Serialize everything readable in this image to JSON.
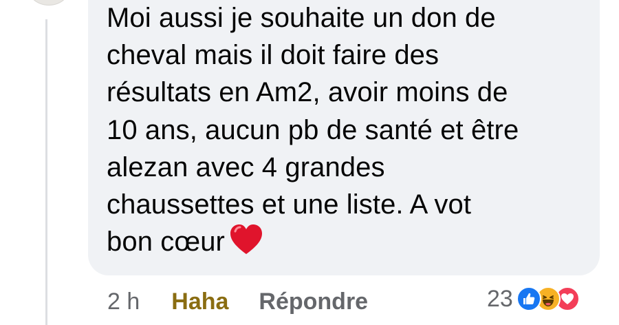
{
  "comment": {
    "lines": [
      "Moi aussi je souhaite un don de",
      "cheval mais il doit faire des",
      "résultats en Am2, avoir moins de",
      "10 ans, aucun pb de santé et être",
      "alezan avec 4 grandes",
      "chaussettes et une liste. A vot",
      "bon cœur"
    ],
    "emoji": "heart-emoji"
  },
  "meta": {
    "time": "2 h",
    "haha_label": "Haha",
    "reply_label": "Répondre"
  },
  "reactions": {
    "count": "23",
    "icons": [
      "like-icon",
      "haha-icon",
      "love-icon"
    ]
  },
  "colors": {
    "bubble": "#f0f2f5",
    "text": "#050505",
    "muted": "#65676b",
    "haha": "#8a6d12",
    "like": "#1877f2",
    "love": "#f33e58",
    "heart": "#e0142c"
  }
}
